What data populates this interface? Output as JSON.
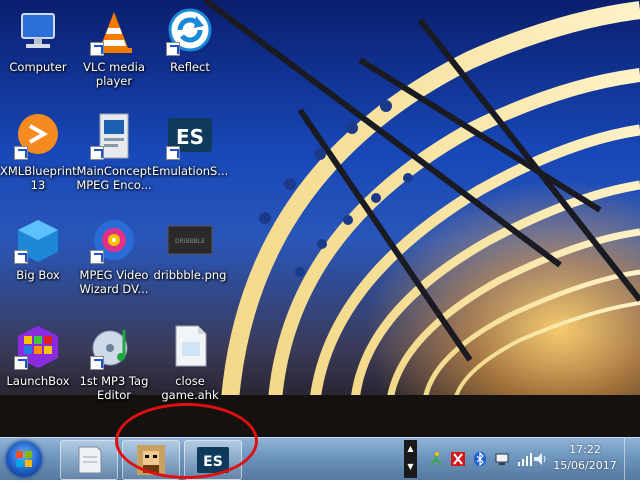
{
  "desktop": {
    "icons": [
      {
        "label": "Computer"
      },
      {
        "label": "VLC media\nplayer"
      },
      {
        "label": "Reflect"
      },
      {
        "label": "XMLBlueprint\n13"
      },
      {
        "label": "MainConcept\nMPEG Enco..."
      },
      {
        "label": "EmulationS..."
      },
      {
        "label": "Big Box"
      },
      {
        "label": "MPEG Video\nWizard DV..."
      },
      {
        "label": "dribbble.png"
      },
      {
        "label": "LaunchBox"
      },
      {
        "label": "1st MP3 Tag\nEditor"
      },
      {
        "label": "close\ngame.ahk"
      }
    ]
  },
  "taskbar": {
    "es_button_text": "ES",
    "clock": {
      "time": "17:22",
      "date": "15/06/2017"
    },
    "scroll_up": "▲",
    "scroll_down": "▼"
  },
  "icon_tiles": {
    "es_text": "ES",
    "thumb_text": "DRIBBBLE"
  }
}
